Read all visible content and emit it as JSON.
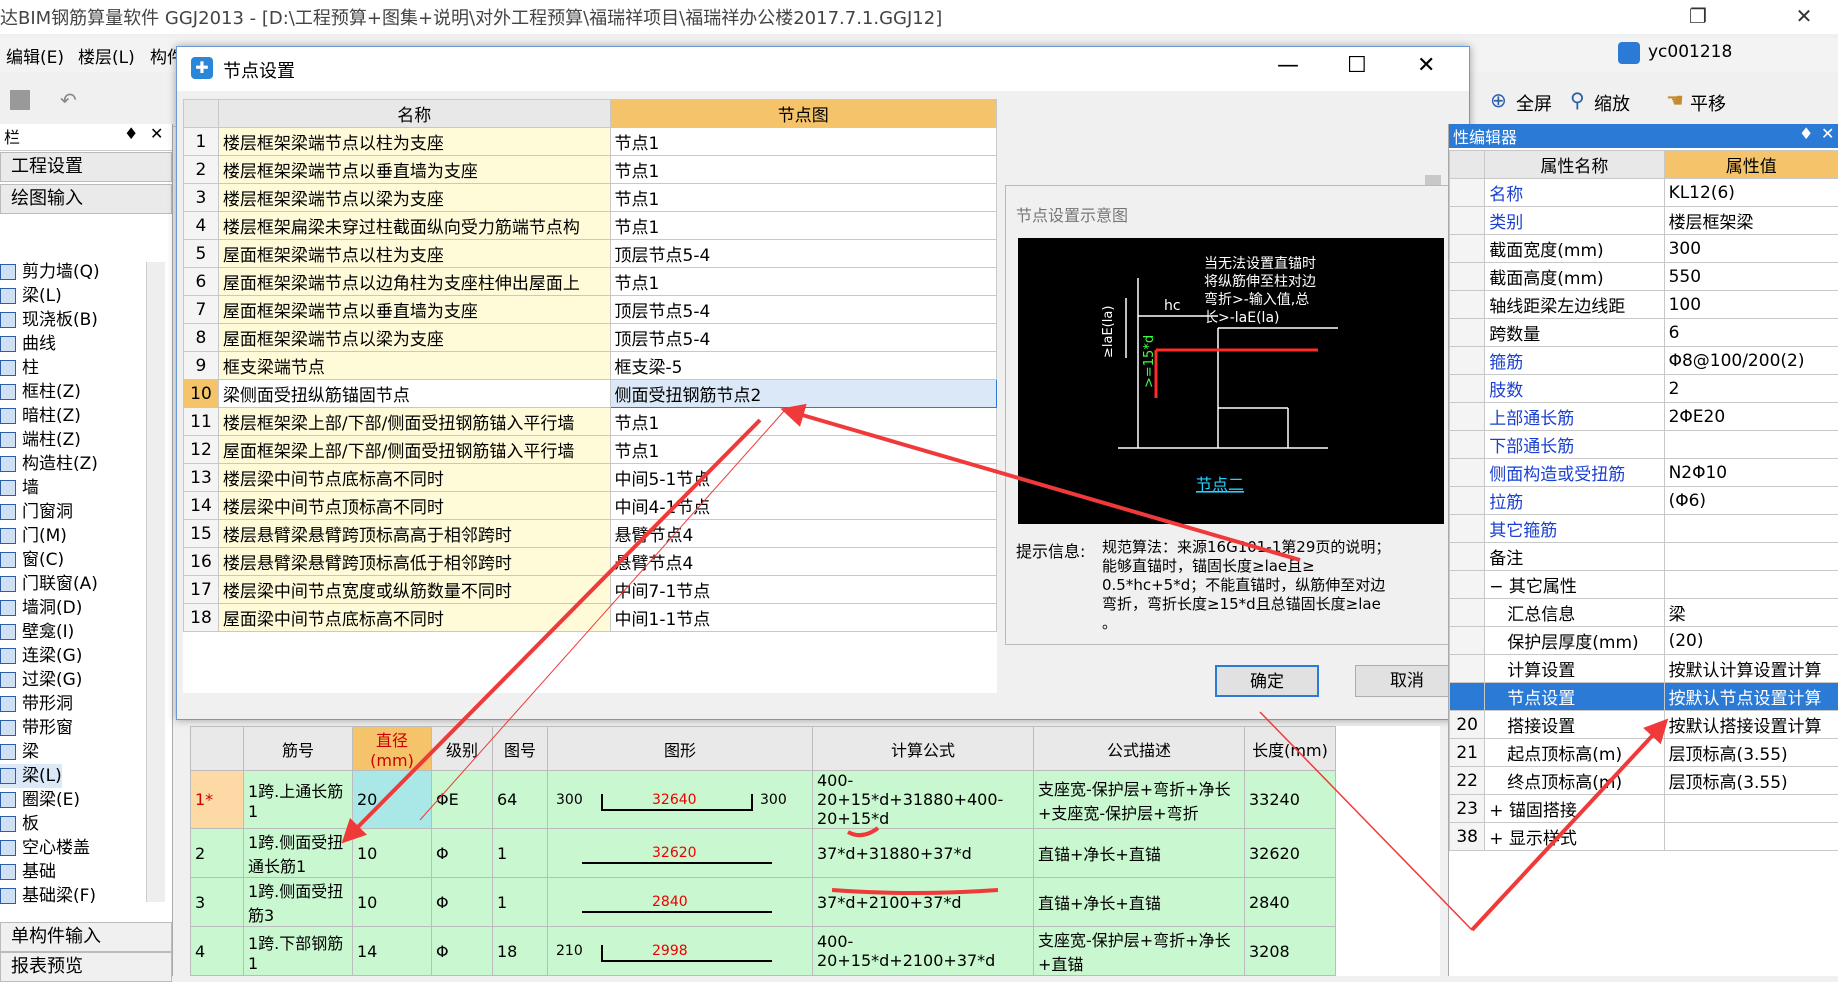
{
  "window": {
    "title": "达BIM钢筋算量软件 GGJ2013 - [D:\\工程预算+图集+说明\\对外工程预算\\福瑞祥项目\\福瑞祥办公楼2017.7.1.GGJ12]",
    "user": "yc001218"
  },
  "menubar": [
    "编辑(E)",
    "楼层(L)",
    "构件"
  ],
  "toolbar_right": {
    "full_screen": "全屏",
    "zoom": "缩放",
    "pan": "平移"
  },
  "left_panel": {
    "header": "栏",
    "btn_project": "工程设置",
    "btn_draw": "绘图输入",
    "items": [
      "剪力墙(Q)",
      "梁(L)",
      "现浇板(B)",
      "曲线",
      "柱",
      "框柱(Z)",
      "暗柱(Z)",
      "端柱(Z)",
      "构造柱(Z)",
      "墙",
      "门窗洞",
      "门(M)",
      "窗(C)",
      "门联窗(A)",
      "墙洞(D)",
      "壁龛(I)",
      "连梁(G)",
      "过梁(G)",
      "带形洞",
      "带形窗",
      "梁",
      "梁(L)",
      "圈梁(E)",
      "板",
      "空心楼盖",
      "基础",
      "基础梁(F)"
    ],
    "bottom1": "单构件输入",
    "bottom2": "报表预览"
  },
  "dialog": {
    "title": "节点设置",
    "col_name": "名称",
    "col_node": "节点图",
    "rows": [
      {
        "n": "1",
        "name": "楼层框架梁端节点以柱为支座",
        "node": "节点1"
      },
      {
        "n": "2",
        "name": "楼层框架梁端节点以垂直墙为支座",
        "node": "节点1"
      },
      {
        "n": "3",
        "name": "楼层框架梁端节点以梁为支座",
        "node": "节点1"
      },
      {
        "n": "4",
        "name": "楼层框架扁梁未穿过柱截面纵向受力筋端节点构",
        "node": "节点1"
      },
      {
        "n": "5",
        "name": "屋面框架梁端节点以柱为支座",
        "node": "顶层节点5-4"
      },
      {
        "n": "6",
        "name": "屋面框架梁端节点以边角柱为支座柱伸出屋面上",
        "node": "节点1"
      },
      {
        "n": "7",
        "name": "屋面框架梁端节点以垂直墙为支座",
        "node": "顶层节点5-4"
      },
      {
        "n": "8",
        "name": "屋面框架梁端节点以梁为支座",
        "node": "顶层节点5-4"
      },
      {
        "n": "9",
        "name": "框支梁端节点",
        "node": "框支梁-5"
      },
      {
        "n": "10",
        "name": "梁侧面受扭纵筋锚固节点",
        "node": "侧面受扭钢筋节点2"
      },
      {
        "n": "11",
        "name": "楼层框架梁上部/下部/侧面受扭钢筋锚入平行墙",
        "node": "节点1"
      },
      {
        "n": "12",
        "name": "屋面框架梁上部/下部/侧面受扭钢筋锚入平行墙",
        "node": "节点1"
      },
      {
        "n": "13",
        "name": "楼层梁中间节点底标高不同时",
        "node": "中间5-1节点"
      },
      {
        "n": "14",
        "name": "楼层梁中间节点顶标高不同时",
        "node": "中间4-1节点"
      },
      {
        "n": "15",
        "name": "楼层悬臂梁悬臂跨顶标高高于相邻跨时",
        "node": "悬臂节点4"
      },
      {
        "n": "16",
        "name": "楼层悬臂梁悬臂跨顶标高低于相邻跨时",
        "node": "悬臂节点4"
      },
      {
        "n": "17",
        "name": "楼层梁中间节点宽度或纵筋数量不同时",
        "node": "中间7-1节点"
      },
      {
        "n": "18",
        "name": "屋面梁中间节点底标高不同时",
        "node": "中间1-1节点"
      }
    ],
    "preview_title": "节点设置示意图",
    "diagram": {
      "note1": "当无法设置直锚时",
      "note2": "将纵筋伸至柱对边",
      "note3": "弯折>-输入值,总",
      "note4": "长>-laE(la)",
      "hc": "hc",
      "dim_vert": "≥laE(la)",
      "dim_bend": ">=15*d",
      "caption": "节点二"
    },
    "hint_label": "提示信息:",
    "hint_text": [
      "规范算法：来源16G101-1第29页的说明；",
      "能够直锚时，锚固长度≥lae且≥",
      "0.5*hc+5*d；不能直锚时，纵筋伸至对边",
      "弯折，弯折长度≥15*d且总锚固长度≥lae",
      "。"
    ],
    "ok": "确定",
    "cancel": "取消"
  },
  "rebar_table": {
    "headers": [
      "",
      "筋号",
      "直径(mm)",
      "级别",
      "图号",
      "图形",
      "计算公式",
      "公式描述",
      "长度(mm)"
    ],
    "rows": [
      {
        "idx": "1*",
        "name": "1跨.上通长筋1",
        "dia": "20",
        "grade": "ΦE",
        "fig": "64",
        "left": "300",
        "mid": "32640",
        "right": "300",
        "formula": "400-20+15*d+31880+400-20+15*d",
        "desc": "支座宽-保护层+弯折+净长+支座宽-保护层+弯折",
        "len": "33240"
      },
      {
        "idx": "2",
        "name": "1跨.侧面受扭通长筋1",
        "dia": "10",
        "grade": "Φ",
        "fig": "1",
        "left": "",
        "mid": "32620",
        "right": "",
        "formula": "37*d+31880+37*d",
        "desc": "直锚+净长+直锚",
        "len": "32620"
      },
      {
        "idx": "3",
        "name": "1跨.侧面受扭筋3",
        "dia": "10",
        "grade": "Φ",
        "fig": "1",
        "left": "",
        "mid": "2840",
        "right": "",
        "formula": "37*d+2100+37*d",
        "desc": "直锚+净长+直锚",
        "len": "2840"
      },
      {
        "idx": "4",
        "name": "1跨.下部钢筋1",
        "dia": "14",
        "grade": "Φ",
        "fig": "18",
        "left": "210",
        "mid": "2998",
        "right": "",
        "formula": "400-20+15*d+2100+37*d",
        "desc": "支座宽-保护层+弯折+净长+直锚",
        "len": "3208"
      }
    ]
  },
  "property_panel": {
    "header": "性编辑器",
    "col_name": "属性名称",
    "col_value": "属性值",
    "rows": [
      {
        "i": "",
        "name": "名称",
        "value": "KL12(6)",
        "blue": true
      },
      {
        "i": "",
        "name": "类别",
        "value": "楼层框架梁",
        "blue": true
      },
      {
        "i": "",
        "name": "截面宽度(mm)",
        "value": "300",
        "blue": false
      },
      {
        "i": "",
        "name": "截面高度(mm)",
        "value": "550",
        "blue": false
      },
      {
        "i": "",
        "name": "轴线距梁左边线距",
        "value": "100",
        "blue": false
      },
      {
        "i": "",
        "name": "跨数量",
        "value": "6",
        "blue": false
      },
      {
        "i": "",
        "name": "箍筋",
        "value": "Φ8@100/200(2)",
        "blue": true
      },
      {
        "i": "",
        "name": "肢数",
        "value": "2",
        "blue": true
      },
      {
        "i": "",
        "name": "上部通长筋",
        "value": "2ΦE20",
        "blue": true
      },
      {
        "i": "",
        "name": "下部通长筋",
        "value": "",
        "blue": true
      },
      {
        "i": "",
        "name": "侧面构造或受扭筋",
        "value": "N2Φ10",
        "blue": true
      },
      {
        "i": "",
        "name": "拉筋",
        "value": "(Φ6)",
        "blue": true
      },
      {
        "i": "",
        "name": "其它箍筋",
        "value": "",
        "blue": true
      },
      {
        "i": "",
        "name": "备注",
        "value": "",
        "blue": false
      },
      {
        "i": "",
        "name": "− 其它属性",
        "value": "",
        "blue": false
      },
      {
        "i": "",
        "name": "汇总信息",
        "value": "梁",
        "blue": false
      },
      {
        "i": "",
        "name": "保护层厚度(mm)",
        "value": "(20)",
        "blue": false
      },
      {
        "i": "",
        "name": "计算设置",
        "value": "按默认计算设置计算",
        "blue": false
      },
      {
        "i": "",
        "name": "节点设置",
        "value": "按默认节点设置计算",
        "blue": false,
        "selected": true
      },
      {
        "i": "20",
        "name": "搭接设置",
        "value": "按默认搭接设置计算",
        "blue": false
      },
      {
        "i": "21",
        "name": "起点顶标高(m)",
        "value": "层顶标高(3.55)",
        "blue": false
      },
      {
        "i": "22",
        "name": "终点顶标高(m)",
        "value": "层顶标高(3.55)",
        "blue": false
      },
      {
        "i": "23",
        "name": "+ 锚固搭接",
        "value": "",
        "blue": false
      },
      {
        "i": "38",
        "name": "+ 显示样式",
        "value": "",
        "blue": false
      }
    ]
  }
}
